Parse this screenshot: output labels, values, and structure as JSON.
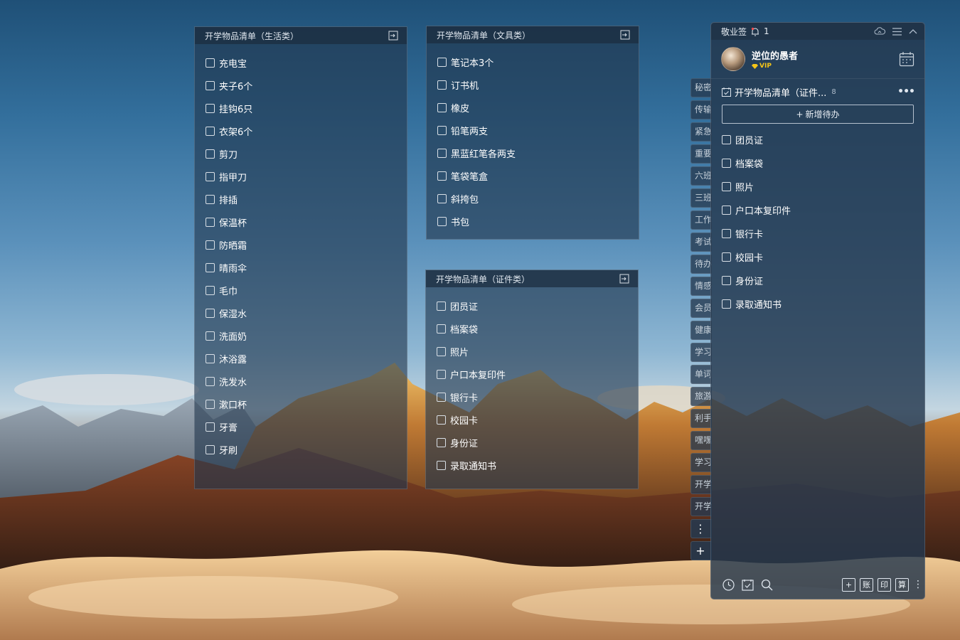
{
  "panel_life": {
    "title": "开学物品清单（生活类）",
    "items": [
      "充电宝",
      "夹子6个",
      "挂钩6只",
      "衣架6个",
      "剪刀",
      "指甲刀",
      "排插",
      "保温杯",
      "防晒霜",
      "晴雨伞",
      "毛巾",
      "保湿水",
      "洗面奶",
      "沐浴露",
      "洗发水",
      "漱口杯",
      "牙膏",
      "牙刷"
    ]
  },
  "panel_stationery": {
    "title": "开学物品清单（文具类）",
    "items": [
      "笔记本3个",
      "订书机",
      "橡皮",
      "铅笔两支",
      "黑蓝红笔各两支",
      "笔袋笔盒",
      "斜挎包",
      "书包"
    ]
  },
  "panel_documents": {
    "title": "开学物品清单（证件类）",
    "items": [
      "团员证",
      "档案袋",
      "照片",
      "户口本复印件",
      "银行卡",
      "校园卡",
      "身份证",
      "录取通知书"
    ]
  },
  "side_tabs": [
    "秘密",
    "传输",
    "紧急",
    "重要",
    "六班",
    "三班",
    "工作",
    "考试",
    "待办",
    "情感",
    "会员",
    "健康",
    "学习",
    "单词",
    "旅游",
    "利手",
    "嘿嘿",
    "学习",
    "开学",
    "开学"
  ],
  "side_tab_buttons": {
    "more": "⋮",
    "add": "+"
  },
  "main": {
    "app_name": "敬业签",
    "notification_count": "1",
    "username": "逆位的愚者",
    "vip_label": "VIP",
    "list_title": "开学物品清单（证件...",
    "list_count": "8",
    "add_todo_label": "新增待办",
    "add_todo_plus": "+",
    "more_label": "•••",
    "items": [
      "团员证",
      "档案袋",
      "照片",
      "户口本复印件",
      "银行卡",
      "校园卡",
      "身份证",
      "录取通知书"
    ],
    "bottom_buttons": {
      "add": "+",
      "account": "账",
      "print": "印",
      "calc": "算",
      "more": "⋮"
    }
  }
}
